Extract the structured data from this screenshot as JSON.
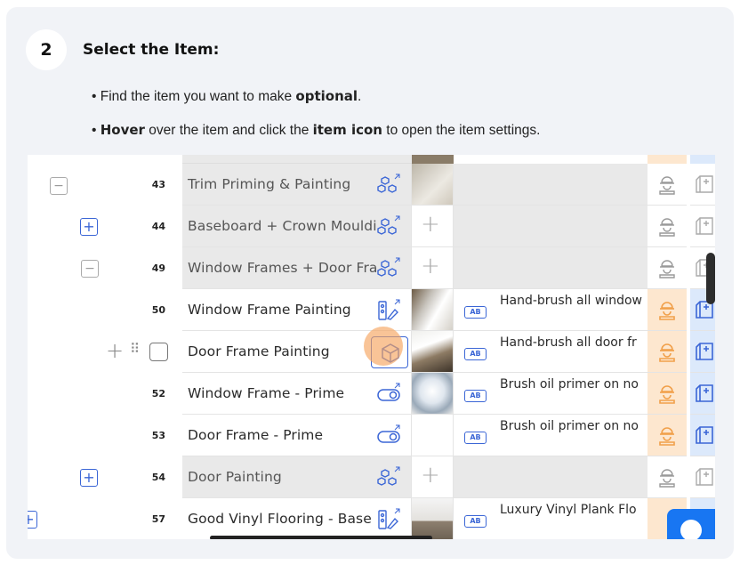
{
  "step": {
    "number": "2",
    "title": "Select the Item:"
  },
  "instructions": [
    {
      "prefix": "• Find the item you want to make ",
      "bold": "optional",
      "suffix": "."
    },
    {
      "prefix": "• ",
      "bold": "Hover",
      "middle": " over the item and click the ",
      "bold2": "item icon",
      "suffix": " to open the item settings."
    }
  ],
  "rows": [
    {
      "num": "43",
      "name": "Trim Priming & Painting",
      "group": true,
      "icon": "package-icon",
      "desc": ""
    },
    {
      "num": "44",
      "name": "Baseboard + Crown Mouldi",
      "group": true,
      "icon": "package-icon",
      "desc": ""
    },
    {
      "num": "49",
      "name": "Window Frames + Door Fra",
      "group": true,
      "icon": "package-icon",
      "desc": ""
    },
    {
      "num": "50",
      "name": "Window Frame Painting",
      "group": false,
      "icon": "paint-icon",
      "desc": "Hand-brush all window"
    },
    {
      "num": "",
      "name": "Door Frame Painting",
      "group": false,
      "icon": "cube-icon",
      "desc": "Hand-brush all door fr"
    },
    {
      "num": "52",
      "name": "Window Frame - Prime",
      "group": false,
      "icon": "toggle-icon",
      "desc": "Brush oil primer on no"
    },
    {
      "num": "53",
      "name": "Door Frame - Prime",
      "group": false,
      "icon": "toggle-icon",
      "desc": "Brush oil primer on no"
    },
    {
      "num": "54",
      "name": "Door Painting",
      "group": true,
      "icon": "package-icon",
      "desc": ""
    },
    {
      "num": "57",
      "name": "Good Vinyl Flooring - Base",
      "group": false,
      "icon": "paint-icon",
      "desc": "Luxury Vinyl Plank Flo"
    }
  ],
  "ab_label": "AB",
  "colors": {
    "accent": "#3b66d6",
    "labor": "#f1a04a",
    "cursor": "#f6a460"
  }
}
